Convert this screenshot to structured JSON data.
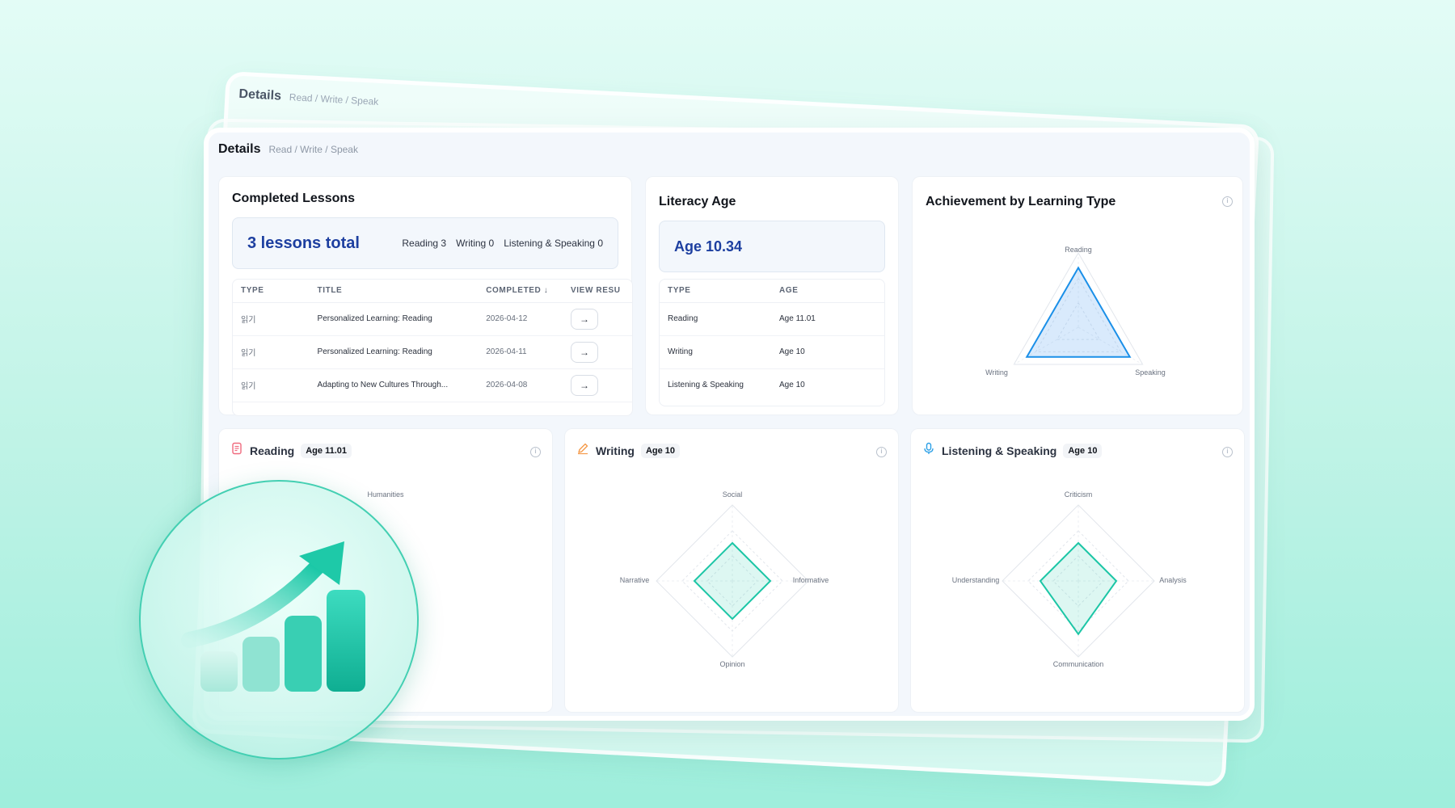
{
  "header": {
    "title": "Details",
    "breadcrumb": "Read / Write / Speak"
  },
  "completed_lessons": {
    "title": "Completed Lessons",
    "total": "3 lessons total",
    "counts": [
      "Reading 3",
      "Writing 0",
      "Listening & Speaking 0"
    ],
    "columns": [
      "TYPE",
      "TITLE",
      "COMPLETED ↓",
      "VIEW RESU"
    ],
    "rows": [
      {
        "type": "읽기",
        "title": "Personalized Learning: Reading",
        "date": "2026-04-12"
      },
      {
        "type": "읽기",
        "title": "Personalized Learning: Reading",
        "date": "2026-04-11"
      },
      {
        "type": "읽기",
        "title": "Adapting to New Cultures Through...",
        "date": "2026-04-08"
      }
    ]
  },
  "literacy_age": {
    "title": "Literacy Age",
    "value": "Age 10.34",
    "columns": [
      "TYPE",
      "AGE"
    ],
    "rows": [
      {
        "type": "Reading",
        "age": "Age 11.01"
      },
      {
        "type": "Writing",
        "age": "Age 10"
      },
      {
        "type": "Listening & Speaking",
        "age": "Age 10"
      }
    ]
  },
  "achievement": {
    "title": "Achievement by Learning Type",
    "axes": [
      "Reading",
      "Speaking",
      "Writing"
    ],
    "values": [
      0.8,
      0.8,
      0.8
    ],
    "color": "#1a8fe8"
  },
  "sections": [
    {
      "name": "Reading",
      "age": "Age 11.01",
      "icon": "document-icon",
      "color": "#f06a7e",
      "axes": [
        "Humanities"
      ]
    },
    {
      "name": "Writing",
      "age": "Age 10",
      "icon": "pencil-icon",
      "color": "#f59a4a",
      "axes": [
        "Social",
        "Informative",
        "Opinion",
        "Narrative"
      ],
      "values": [
        0.5,
        0.5,
        0.5,
        0.5
      ]
    },
    {
      "name": "Listening & Speaking",
      "age": "Age 10",
      "icon": "microphone-icon",
      "color": "#2a9fe6",
      "axes": [
        "Criticism",
        "Analysis",
        "Communication",
        "Understanding"
      ],
      "values": [
        0.5,
        0.5,
        0.7,
        0.5
      ]
    }
  ],
  "colors": {
    "radar_teal": "#1cc6a6",
    "accent_blue": "#1d3fa0"
  }
}
